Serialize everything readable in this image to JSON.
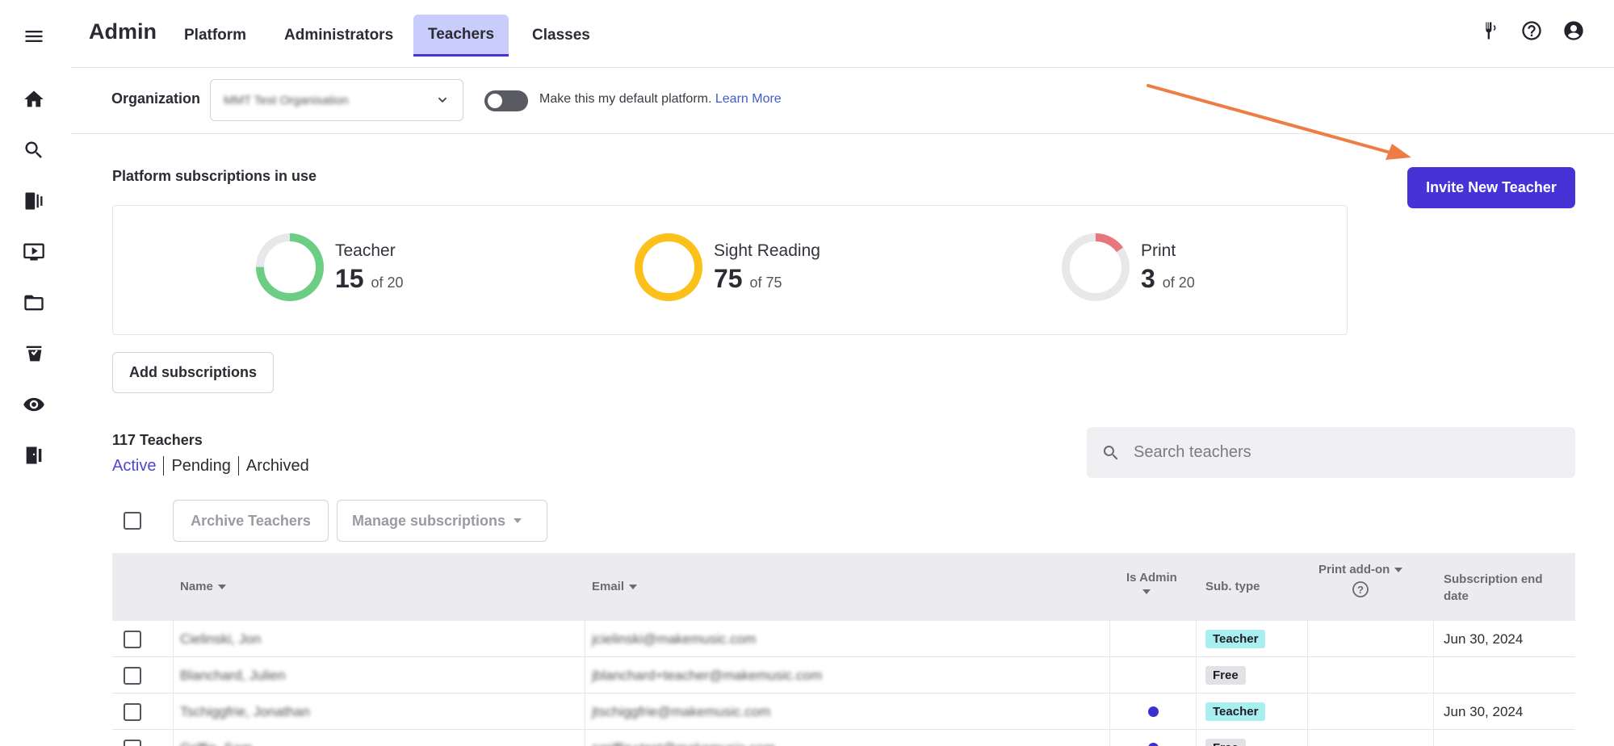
{
  "app": {
    "title": "Admin"
  },
  "nav": {
    "tabs": [
      "Platform",
      "Administrators",
      "Teachers",
      "Classes"
    ],
    "active": "Teachers"
  },
  "sidebar": {
    "icons": [
      "menu-icon",
      "home-icon",
      "search-icon",
      "library-icon",
      "video-icon",
      "folder-icon",
      "assignment-icon",
      "eye-icon",
      "exit-icon"
    ]
  },
  "topIcons": [
    "tuner-icon",
    "help-icon",
    "account-icon"
  ],
  "org": {
    "label": "Organization",
    "value": "MMT Test Organisation",
    "toggle_text": "Make this my default platform.",
    "learn_more": "Learn More",
    "toggle_on": false
  },
  "subscriptions": {
    "title": "Platform subscriptions in use",
    "items": [
      {
        "name": "Teacher",
        "used": "15",
        "of": "of 20",
        "fraction": 0.75,
        "color": "#6cce84"
      },
      {
        "name": "Sight Reading",
        "used": "75",
        "of": "of 75",
        "fraction": 1.0,
        "color": "#fbc01a"
      },
      {
        "name": "Print",
        "used": "3",
        "of": "of 20",
        "fraction": 0.15,
        "color": "#e8777d"
      }
    ],
    "add_label": "Add subscriptions"
  },
  "invite": {
    "label": "Invite New Teacher"
  },
  "teachers": {
    "count": "117 Teachers",
    "filters": [
      "Active",
      "Pending",
      "Archived"
    ],
    "active_filter": "Active",
    "search_placeholder": "Search teachers",
    "archive_label": "Archive Teachers",
    "manage_label": "Manage subscriptions"
  },
  "table": {
    "headers": {
      "name": "Name",
      "email": "Email",
      "is_admin": "Is Admin",
      "sub_type": "Sub. type",
      "print_addon": "Print add-on",
      "sub_end_1": "Subscription end",
      "sub_end_2": "date"
    },
    "rows": [
      {
        "name": "Cielinski, Jon",
        "email": "jcielinski@makemusic.com",
        "admin": false,
        "sub": "Teacher",
        "sub_color": "#a9eff0",
        "end": "Jun 30, 2024"
      },
      {
        "name": "Blanchard, Julien",
        "email": "jblanchard+teacher@makemusic.com",
        "admin": false,
        "sub": "Free",
        "sub_color": "#e2e2e6",
        "end": ""
      },
      {
        "name": "Tschiggfrie, Jonathan",
        "email": "jtschiggfrie@makemusic.com",
        "admin": true,
        "sub": "Teacher",
        "sub_color": "#a9eff0",
        "end": "Jun 30, 2024"
      },
      {
        "name": "Griffin, Sam",
        "email": "sgriffin+test@makemusic.com",
        "admin": true,
        "sub": "Free",
        "sub_color": "#e2e2e6",
        "end": ""
      }
    ]
  },
  "colors": {
    "accent": "#4533d6",
    "tab_active_bg": "#c9cdfb",
    "arrow": "#ee7c45"
  }
}
